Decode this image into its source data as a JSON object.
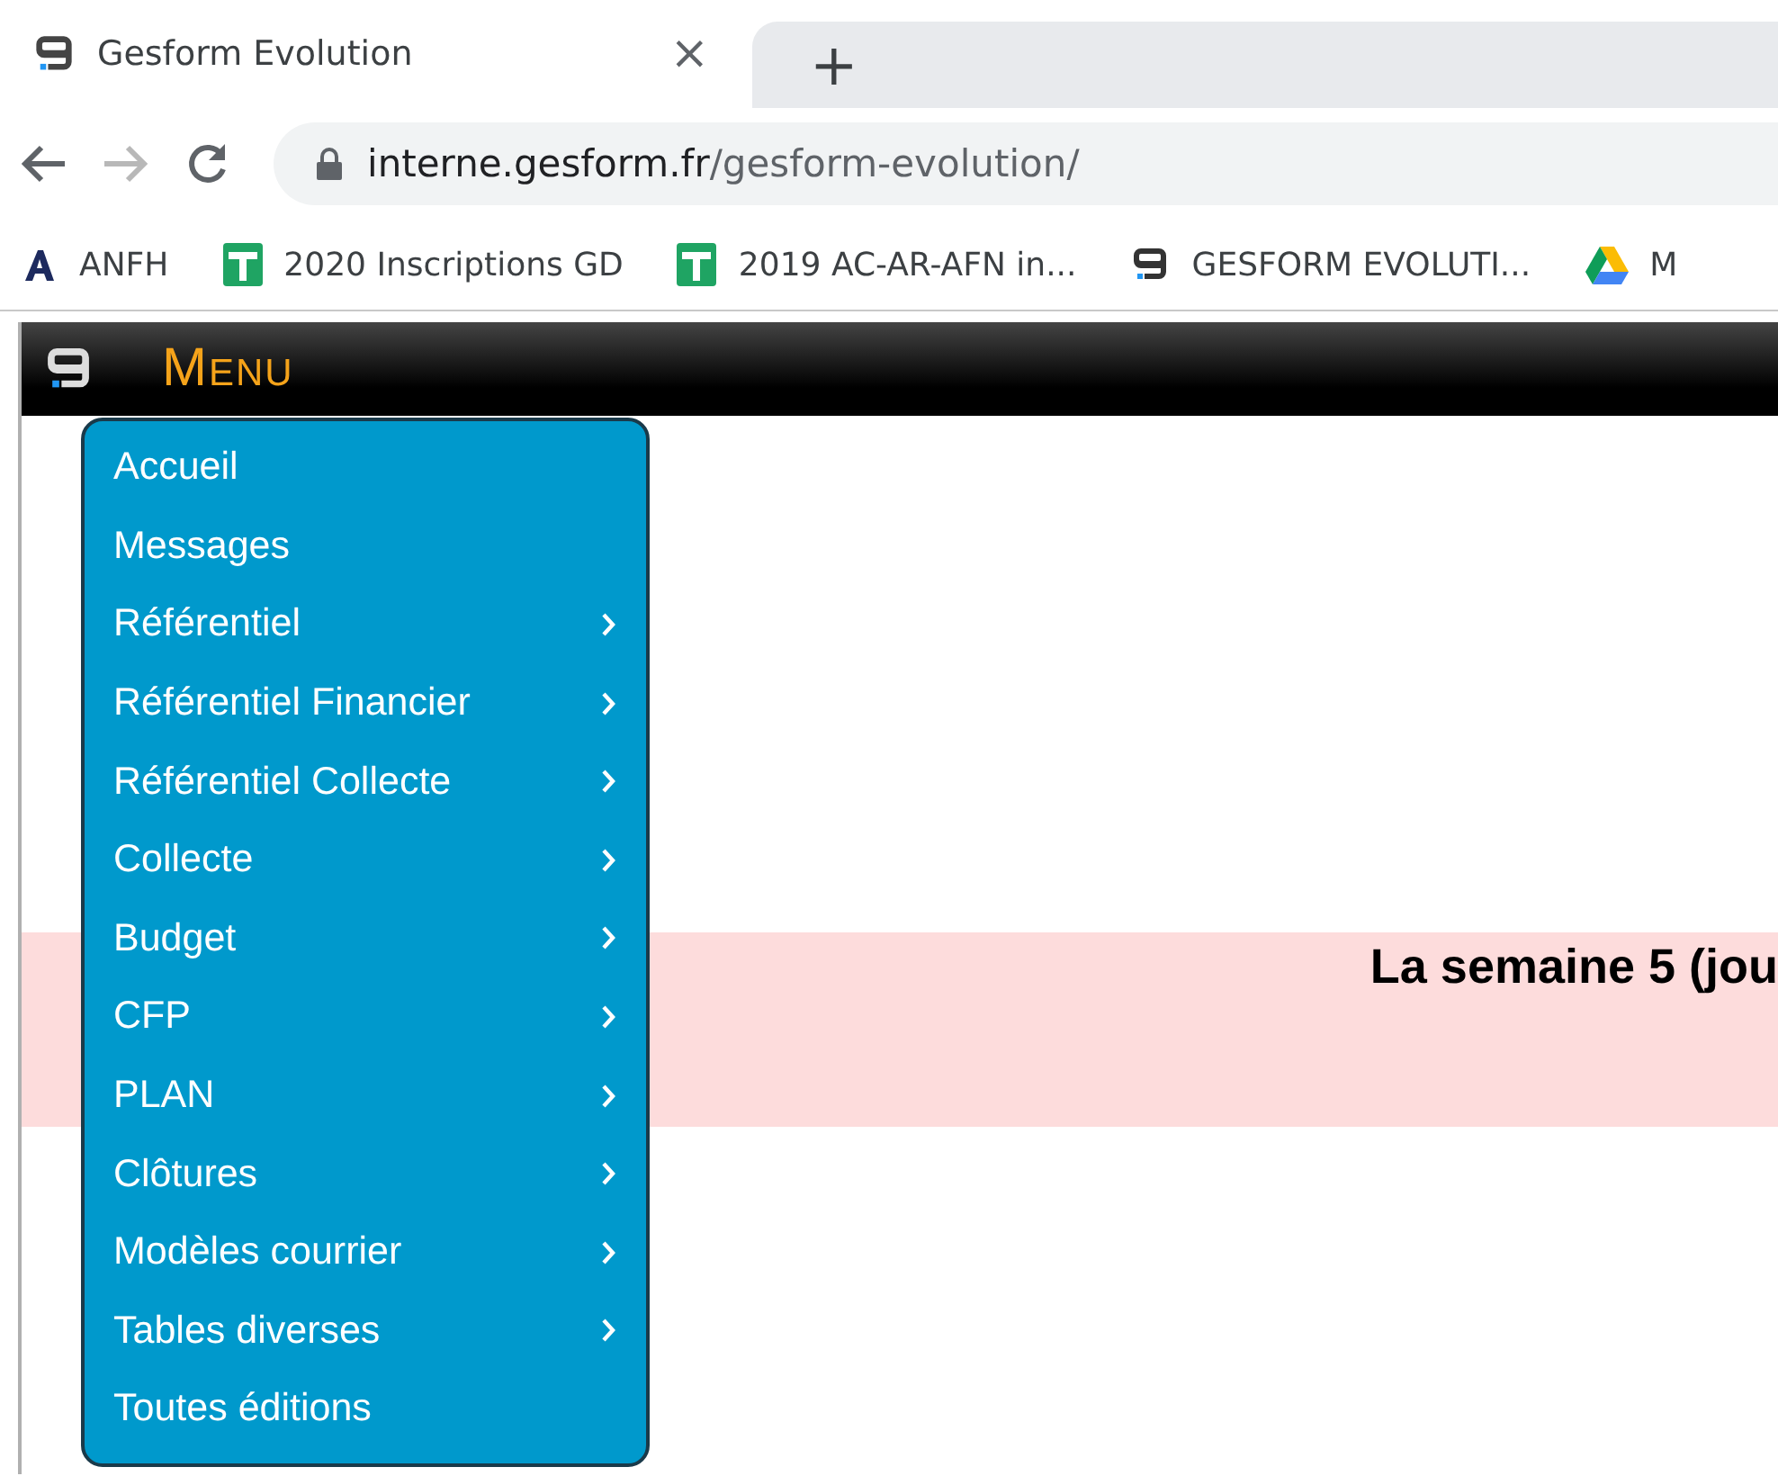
{
  "browser": {
    "tab": {
      "title": "Gesform Evolution",
      "close": "×"
    },
    "new_tab": "+",
    "url": {
      "host": "interne.gesform.fr",
      "path": "/gesform-evolution/"
    },
    "bookmarks": [
      {
        "kind": "anfh",
        "label": "ANFH"
      },
      {
        "kind": "sheet",
        "label": "2020 Inscriptions GD"
      },
      {
        "kind": "sheet",
        "label": "2019 AC-AR-AFN in..."
      },
      {
        "kind": "logo",
        "label": "GESFORM EVOLUTI..."
      },
      {
        "kind": "drive",
        "label": "M"
      }
    ]
  },
  "header": {
    "title": "Menu"
  },
  "menu": {
    "items": [
      {
        "label": "Accueil",
        "submenu": false
      },
      {
        "label": "Messages",
        "submenu": false
      },
      {
        "label": "Référentiel",
        "submenu": true
      },
      {
        "label": "Référentiel Financier",
        "submenu": true
      },
      {
        "label": "Référentiel Collecte",
        "submenu": true
      },
      {
        "label": "Collecte",
        "submenu": true
      },
      {
        "label": "Budget",
        "submenu": true
      },
      {
        "label": "CFP",
        "submenu": true
      },
      {
        "label": "PLAN",
        "submenu": true
      },
      {
        "label": "Clôtures",
        "submenu": true
      },
      {
        "label": "Modèles courrier",
        "submenu": true
      },
      {
        "label": "Tables diverses",
        "submenu": true
      },
      {
        "label": "Toutes éditions",
        "submenu": false
      }
    ]
  },
  "notice": {
    "title": "La semaine 5 (jou"
  }
}
